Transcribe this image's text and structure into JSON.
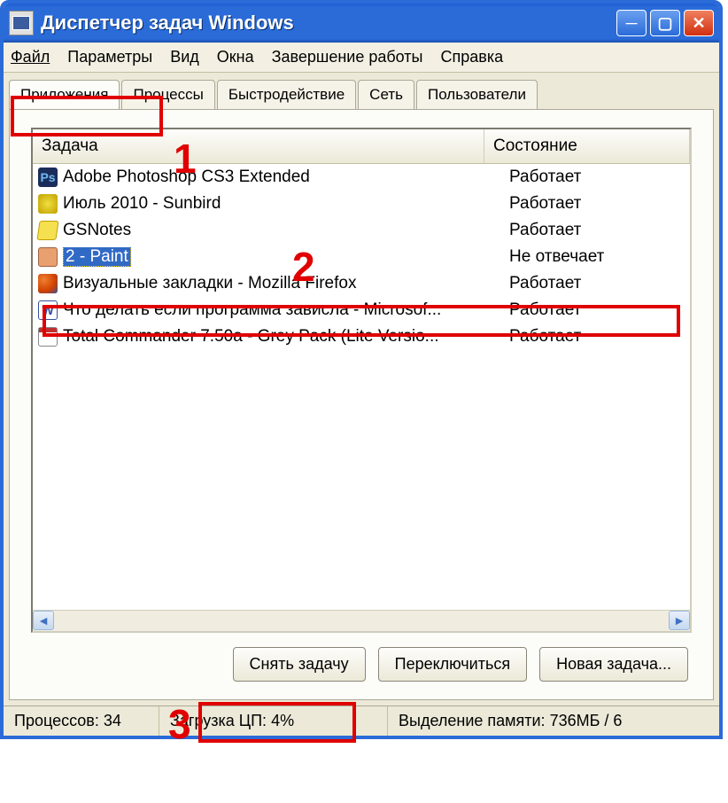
{
  "window": {
    "title": "Диспетчер задач Windows"
  },
  "menu": {
    "file": "Файл",
    "options": "Параметры",
    "view": "Вид",
    "windows": "Окна",
    "shutdown": "Завершение работы",
    "help": "Справка"
  },
  "tabs": {
    "applications": "Приложения",
    "processes": "Процессы",
    "performance": "Быстродействие",
    "network": "Сеть",
    "users": "Пользователи"
  },
  "columns": {
    "task": "Задача",
    "status": "Состояние"
  },
  "rows": [
    {
      "icon": "ps",
      "task": "Adobe Photoshop CS3 Extended",
      "status": "Работает",
      "selected": false
    },
    {
      "icon": "sb",
      "task": "Июль 2010 - Sunbird",
      "status": "Работает",
      "selected": false
    },
    {
      "icon": "gs",
      "task": "GSNotes",
      "status": "Работает",
      "selected": false
    },
    {
      "icon": "pt",
      "task": "2 - Paint",
      "status": "Не отвечает",
      "selected": true
    },
    {
      "icon": "ff",
      "task": "Визуальные закладки - Mozilla Firefox",
      "status": "Работает",
      "selected": false
    },
    {
      "icon": "wd",
      "task": "Что делать если программа зависла - Microsof...",
      "status": "Работает",
      "selected": false
    },
    {
      "icon": "tc",
      "task": "Total Commander 7.50a - Grey Pack  (Lite Versio...",
      "status": "Работает",
      "selected": false
    }
  ],
  "buttons": {
    "end_task": "Снять задачу",
    "switch_to": "Переключиться",
    "new_task": "Новая задача..."
  },
  "status": {
    "processes_label": "Процессов:",
    "processes_value": "34",
    "cpu_label": "Загрузка ЦП:",
    "cpu_value": "4%",
    "mem_label": "Выделение памяти:",
    "mem_value": "736МБ / 6"
  },
  "annotations": {
    "n1": "1",
    "n2": "2",
    "n3": "3"
  }
}
